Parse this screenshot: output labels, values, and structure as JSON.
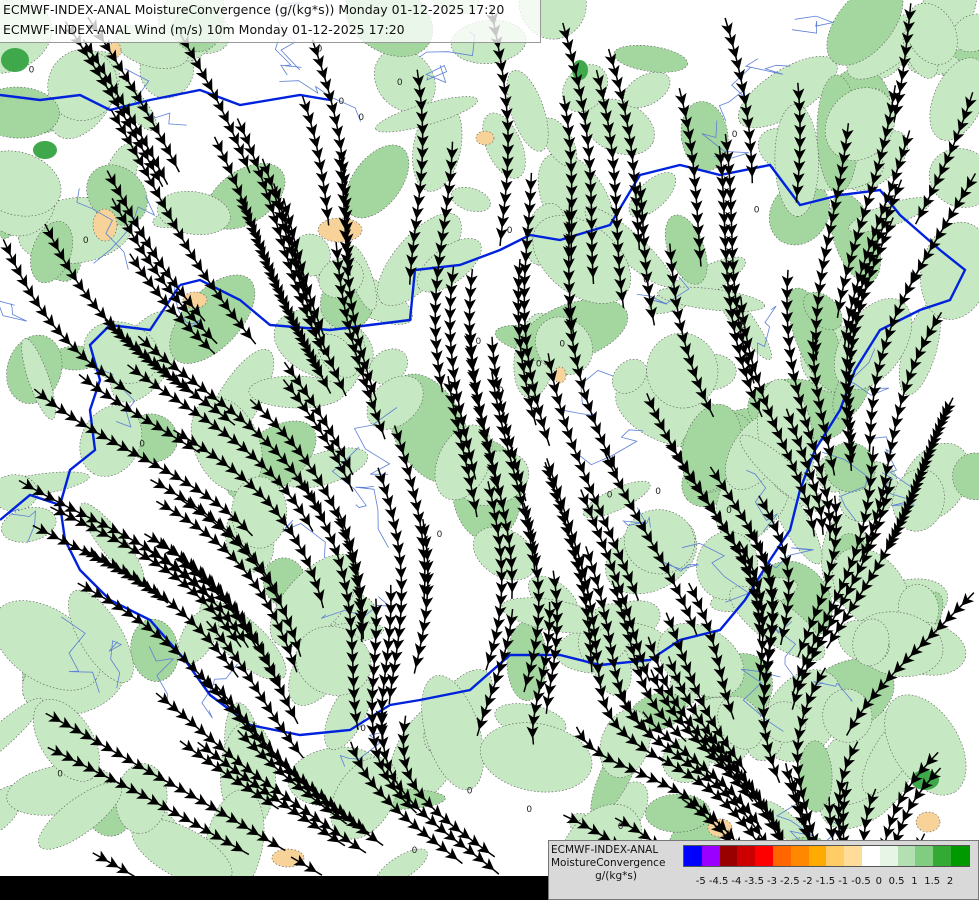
{
  "title_lines": [
    "ECMWF-INDEX-ANAL MoistureConvergence (g/(kg*s)) Monday 01-12-2025 17:20",
    "ECMWF-INDEX-ANAL Wind (m/s) 10m Monday 01-12-2025 17:20"
  ],
  "legend": {
    "title1": "ECMWF-INDEX-ANAL",
    "title2": "MoistureConvergence",
    "unit": "g/(kg*s)",
    "swatches": [
      "#0000ff",
      "#9900ff",
      "#990000",
      "#cc0000",
      "#ff0000",
      "#ff6600",
      "#ff8800",
      "#ffaa00",
      "#ffcc66",
      "#ffdd99",
      "#ffffff",
      "#e6f5e6",
      "#b3e0b3",
      "#80cc80",
      "#33aa33",
      "#009900"
    ],
    "ticks": [
      "-5",
      "-4.5",
      "-4",
      "-3.5",
      "-3",
      "-2.5",
      "-2",
      "-1.5",
      "-1",
      "-0.5",
      "0",
      "0.5",
      "1",
      "1.5",
      "2"
    ]
  },
  "colors": {
    "green_light": "#c6e8c2",
    "green_mid": "#a4d79f",
    "green_dark": "#3fa84a",
    "orange_light": "#f7d39a",
    "border": "#0022dd",
    "river": "#5c7fd6",
    "stream": "#000000"
  }
}
